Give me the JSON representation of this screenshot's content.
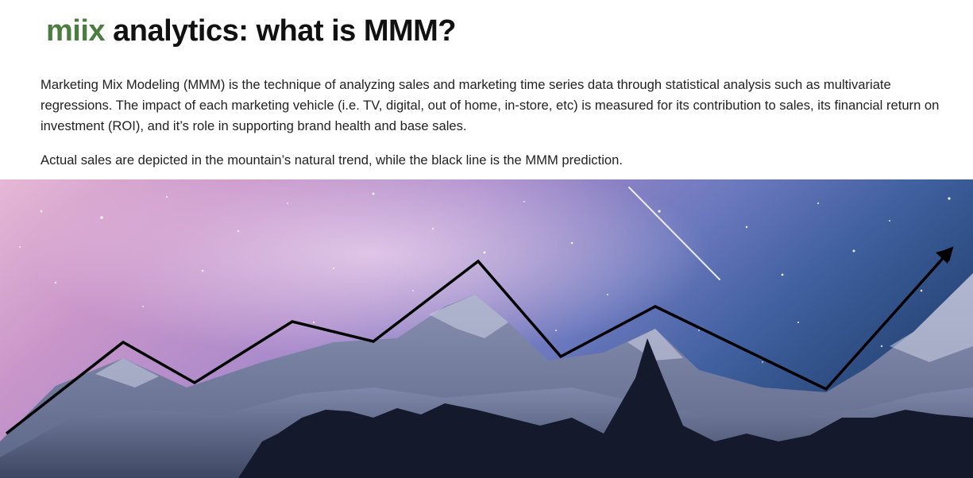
{
  "header": {
    "brand": "miix",
    "title_rest": " analytics:  what is MMM?"
  },
  "body": {
    "description": "Marketing Mix Modeling (MMM) is the technique of analyzing sales and marketing time series data through statistical analysis such as multivariate regressions.  The impact of each marketing vehicle (i.e. TV, digital, out of home, in-store, etc) is measured for its contribution to sales, its financial return on investment (ROI), and it’s role in supporting brand health and base sales.",
    "note": "Actual sales are depicted in the mountain’s natural trend, while the black line is the MMM prediction."
  },
  "colors": {
    "brand": "#4a7d3f",
    "text": "#222222",
    "prediction_line": "#000000"
  },
  "illustration": {
    "subject": "starry night sky over snowy mountain range",
    "prediction_arrow": "trend-arrow-icon"
  }
}
